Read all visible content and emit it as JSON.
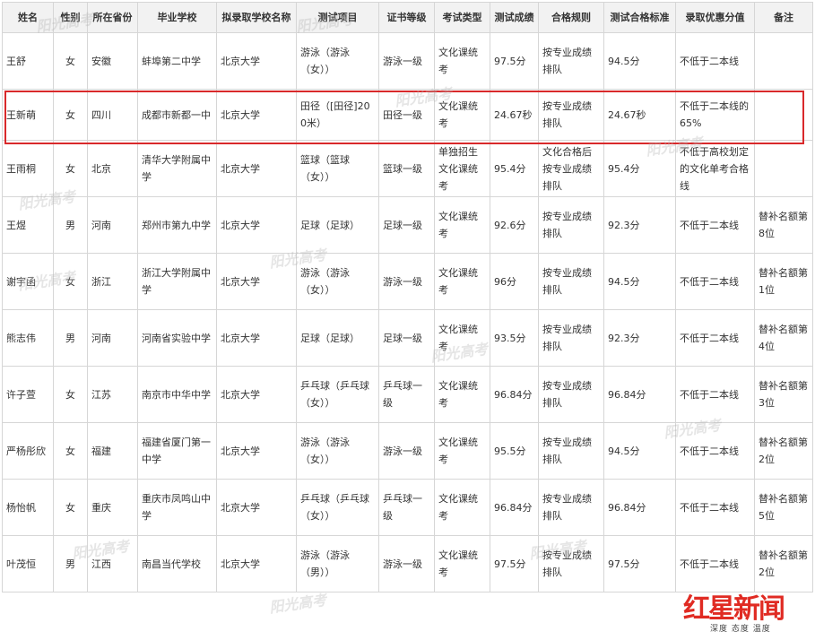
{
  "table": {
    "headers": [
      "姓名",
      "性别",
      "所在省份",
      "毕业学校",
      "拟录取学校名称",
      "测试项目",
      "证书等级",
      "考试类型",
      "测试成绩",
      "合格规则",
      "测试合格标准",
      "录取优惠分值",
      "备注"
    ],
    "rows": [
      {
        "name": "王舒",
        "gender": "女",
        "province": "安徽",
        "school": "蚌埠第二中学",
        "target": "北京大学",
        "event": "游泳（游泳（女））",
        "level": "游泳一级",
        "exam": "文化课统考",
        "score": "97.5分",
        "rule": "按专业成绩排队",
        "standard": "94.5分",
        "bonus": "不低于二本线",
        "note": ""
      },
      {
        "name": "王新萌",
        "gender": "女",
        "province": "四川",
        "school": "成都市新都一中",
        "target": "北京大学",
        "event": "田径（[田径]200米）",
        "level": "田径一级",
        "exam": "文化课统考",
        "score": "24.67秒",
        "rule": "按专业成绩排队",
        "standard": "24.67秒",
        "bonus": "不低于二本线的65%",
        "note": ""
      },
      {
        "name": "王雨桐",
        "gender": "女",
        "province": "北京",
        "school": "清华大学附属中学",
        "target": "北京大学",
        "event": "篮球（篮球（女））",
        "level": "篮球一级",
        "exam": "单独招生文化课统考",
        "score": "95.4分",
        "rule": "文化合格后按专业成绩排队",
        "standard": "95.4分",
        "bonus": "不低于高校划定的文化单考合格线",
        "note": ""
      },
      {
        "name": "王煜",
        "gender": "男",
        "province": "河南",
        "school": "郑州市第九中学",
        "target": "北京大学",
        "event": "足球（足球）",
        "level": "足球一级",
        "exam": "文化课统考",
        "score": "92.6分",
        "rule": "按专业成绩排队",
        "standard": "92.3分",
        "bonus": "不低于二本线",
        "note": "替补名额第8位"
      },
      {
        "name": "谢宇函",
        "gender": "女",
        "province": "浙江",
        "school": "浙江大学附属中学",
        "target": "北京大学",
        "event": "游泳（游泳（女））",
        "level": "游泳一级",
        "exam": "文化课统考",
        "score": "96分",
        "rule": "按专业成绩排队",
        "standard": "94.5分",
        "bonus": "不低于二本线",
        "note": "替补名额第1位"
      },
      {
        "name": "熊志伟",
        "gender": "男",
        "province": "河南",
        "school": "河南省实验中学",
        "target": "北京大学",
        "event": "足球（足球）",
        "level": "足球一级",
        "exam": "文化课统考",
        "score": "93.5分",
        "rule": "按专业成绩排队",
        "standard": "92.3分",
        "bonus": "不低于二本线",
        "note": "替补名额第4位"
      },
      {
        "name": "许子萱",
        "gender": "女",
        "province": "江苏",
        "school": "南京市中华中学",
        "target": "北京大学",
        "event": "乒乓球（乒乓球（女））",
        "level": "乒乓球一级",
        "exam": "文化课统考",
        "score": "96.84分",
        "rule": "按专业成绩排队",
        "standard": "96.84分",
        "bonus": "不低于二本线",
        "note": "替补名额第3位"
      },
      {
        "name": "严杨彤欣",
        "gender": "女",
        "province": "福建",
        "school": "福建省厦门第一中学",
        "target": "北京大学",
        "event": "游泳（游泳（女））",
        "level": "游泳一级",
        "exam": "文化课统考",
        "score": "95.5分",
        "rule": "按专业成绩排队",
        "standard": "94.5分",
        "bonus": "不低于二本线",
        "note": "替补名额第2位"
      },
      {
        "name": "杨怡帆",
        "gender": "女",
        "province": "重庆",
        "school": "重庆市凤鸣山中学",
        "target": "北京大学",
        "event": "乒乓球（乒乓球（女））",
        "level": "乒乓球一级",
        "exam": "文化课统考",
        "score": "96.84分",
        "rule": "按专业成绩排队",
        "standard": "96.84分",
        "bonus": "不低于二本线",
        "note": "替补名额第5位"
      },
      {
        "name": "叶茂恒",
        "gender": "男",
        "province": "江西",
        "school": "南昌当代学校",
        "target": "北京大学",
        "event": "游泳（游泳（男））",
        "level": "游泳一级",
        "exam": "文化课统考",
        "score": "97.5分",
        "rule": "按专业成绩排队",
        "standard": "97.5分",
        "bonus": "不低于二本线",
        "note": "替补名额第2位"
      }
    ]
  },
  "watermark": "阳光高考",
  "logo": {
    "title": "红星新闻",
    "subtitle": "深度 态度 温度",
    "accent": "#e02b23"
  },
  "colors": {
    "highlight_border": "#d9292b",
    "header_bg": "#f2f2f2",
    "grid_line": "#d6d6d6"
  }
}
